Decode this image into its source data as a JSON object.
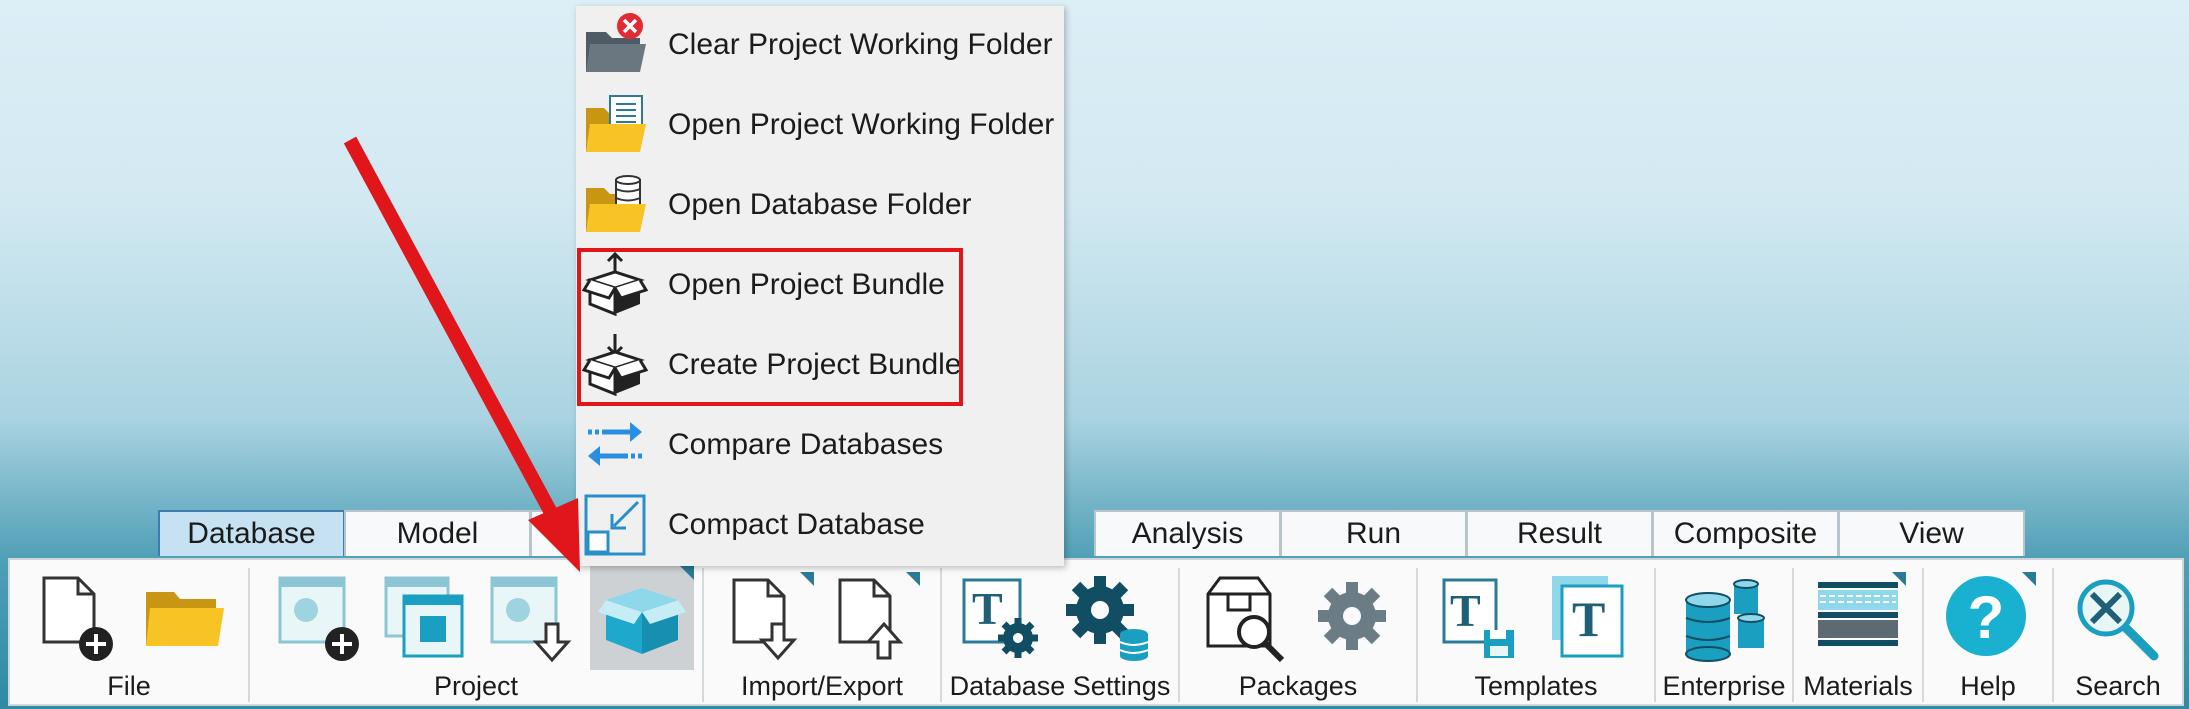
{
  "tabs": [
    {
      "label": "Database",
      "active": true
    },
    {
      "label": "Model",
      "active": false
    },
    {
      "label": "",
      "active": false
    },
    {
      "label": "Analysis",
      "active": false
    },
    {
      "label": "Run",
      "active": false
    },
    {
      "label": "Result",
      "active": false
    },
    {
      "label": "Composite",
      "active": false
    },
    {
      "label": "View",
      "active": false
    }
  ],
  "ribbon": {
    "groups": {
      "file": "File",
      "project": "Project",
      "import_export": "Import/Export",
      "database_settings": "Database Settings",
      "packages": "Packages",
      "templates": "Templates",
      "enterprise": "Enterprise",
      "materials": "Materials",
      "help": "Help",
      "search": "Search"
    }
  },
  "menu": {
    "items": [
      {
        "label": "Clear Project Working Folder",
        "icon": "folder-clear-icon"
      },
      {
        "label": "Open Project Working Folder",
        "icon": "folder-document-icon"
      },
      {
        "label": "Open Database Folder",
        "icon": "folder-database-icon"
      },
      {
        "label": "Open Project Bundle",
        "icon": "box-upload-icon"
      },
      {
        "label": "Create Project Bundle",
        "icon": "box-download-icon"
      },
      {
        "label": "Compare Databases",
        "icon": "compare-arrows-icon"
      },
      {
        "label": "Compact Database",
        "icon": "compact-icon"
      }
    ]
  },
  "colors": {
    "accent": "#2b7a96",
    "annotation": "#e0161b",
    "folder_yellow": "#f6c12a",
    "teal": "#1b9fc0"
  }
}
